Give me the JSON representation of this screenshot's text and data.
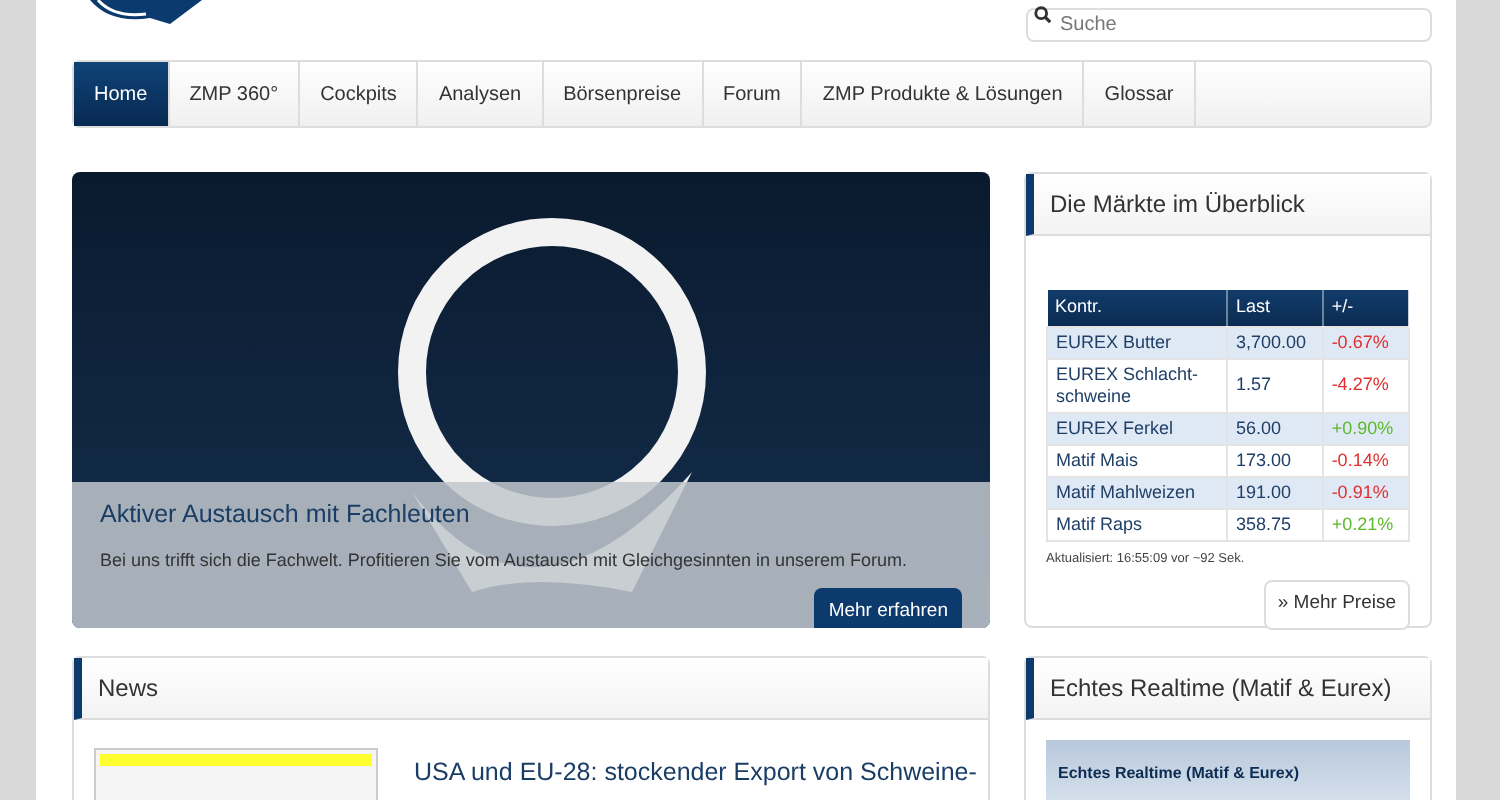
{
  "search": {
    "placeholder": "Suche"
  },
  "nav": [
    {
      "label": "Home",
      "selected": true
    },
    {
      "label": "ZMP 360°",
      "selected": false
    },
    {
      "label": "Cockpits",
      "selected": false
    },
    {
      "label": "Analysen",
      "selected": false
    },
    {
      "label": "Börsenpreise",
      "selected": false
    },
    {
      "label": "Forum",
      "selected": false
    },
    {
      "label": "ZMP Produkte & Lösungen",
      "selected": false
    },
    {
      "label": "Glossar",
      "selected": false
    }
  ],
  "hero": {
    "title": "Aktiver Austausch mit Fachleuten",
    "text": "Bei uns trifft sich die Fachwelt. Profitieren Sie vom Austausch mit Gleichgesinnten in unserem Forum.",
    "button": "Mehr erfahren"
  },
  "markets": {
    "title": "Die Märkte im Überblick",
    "columns": [
      "Kontr.",
      "Last",
      "+/-"
    ],
    "rows": [
      {
        "name": "EUREX Butter",
        "last": "3,700.00",
        "change": "-0.67%",
        "color": "#e03030"
      },
      {
        "name": "EUREX Schlacht-schweine",
        "last": "1.57",
        "change": "-4.27%",
        "color": "#e03030"
      },
      {
        "name": "EUREX Ferkel",
        "last": "56.00",
        "change": "+0.90%",
        "color": "#5cb82a"
      },
      {
        "name": "Matif Mais",
        "last": "173.00",
        "change": "-0.14%",
        "color": "#e03030"
      },
      {
        "name": "Matif Mahlweizen",
        "last": "191.00",
        "change": "-0.91%",
        "color": "#e03030"
      },
      {
        "name": "Matif Raps",
        "last": "358.75",
        "change": "+0.21%",
        "color": "#5cb82a"
      }
    ],
    "updated": "Aktualisiert: 16:55:09 vor ~92 Sek.",
    "button": "» Mehr Preise"
  },
  "news": {
    "title": "News",
    "headline": "USA und EU-28: stockender Export von Schweine-"
  },
  "realtime": {
    "title": "Echtes Realtime (Matif & Eurex)",
    "banner": "Echtes Realtime (Matif & Eurex)"
  }
}
